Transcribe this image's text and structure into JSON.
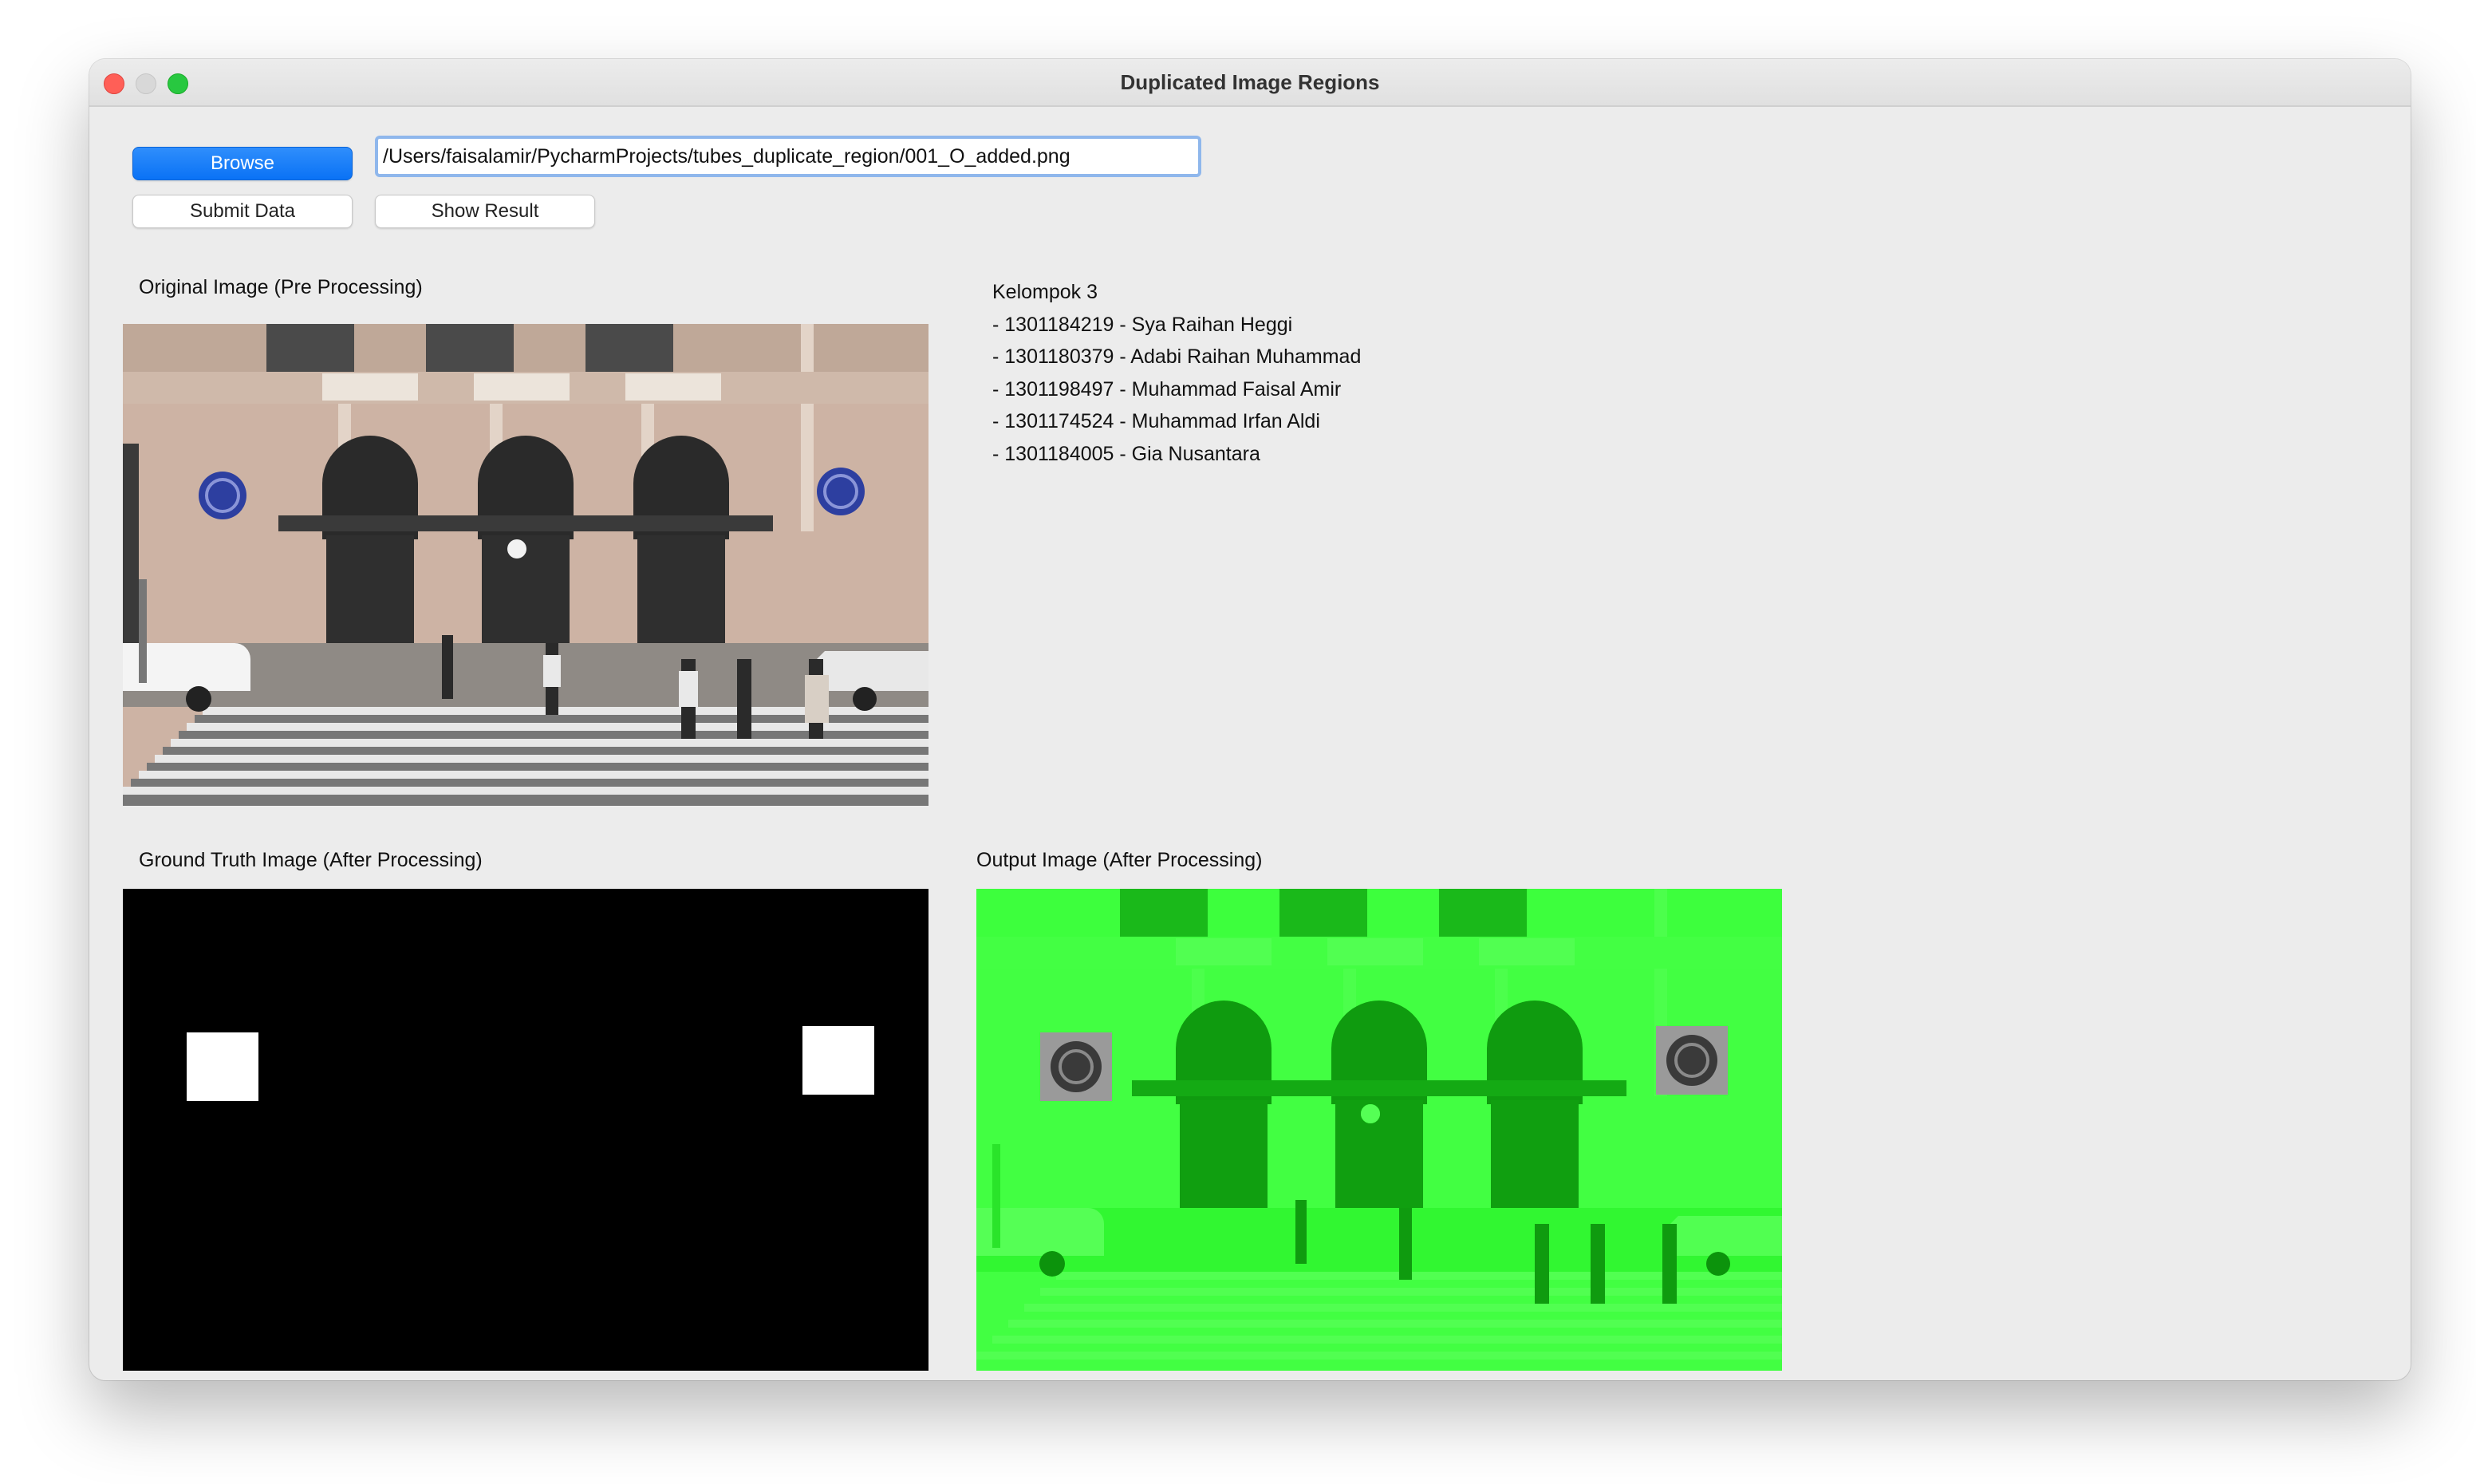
{
  "window": {
    "title": "Duplicated Image Regions"
  },
  "toolbar": {
    "browse_label": "Browse",
    "submit_label": "Submit Data",
    "show_result_label": "Show Result",
    "path_value": "/Users/faisalamir/PycharmProjects/tubes_duplicate_region/001_O_added.png"
  },
  "panels": {
    "original_label": "Original Image (Pre Processing)",
    "ground_truth_label": "Ground Truth Image (After Processing)",
    "output_label": "Output Image (After Processing)"
  },
  "group": {
    "title": "Kelompok 3",
    "members": [
      "- 1301184219 - Sya Raihan Heggi",
      "- 1301180379 - Adabi Raihan Muhammad",
      "- 1301198497 - Muhammad Faisal Amir",
      "- 1301174524 - Muhammad Irfan Aldi",
      "- 1301184005 - Gia Nusantara"
    ]
  },
  "colors": {
    "accent": "#0a72f5",
    "window_bg": "#ececec",
    "output_tint": "#3cff3c"
  }
}
